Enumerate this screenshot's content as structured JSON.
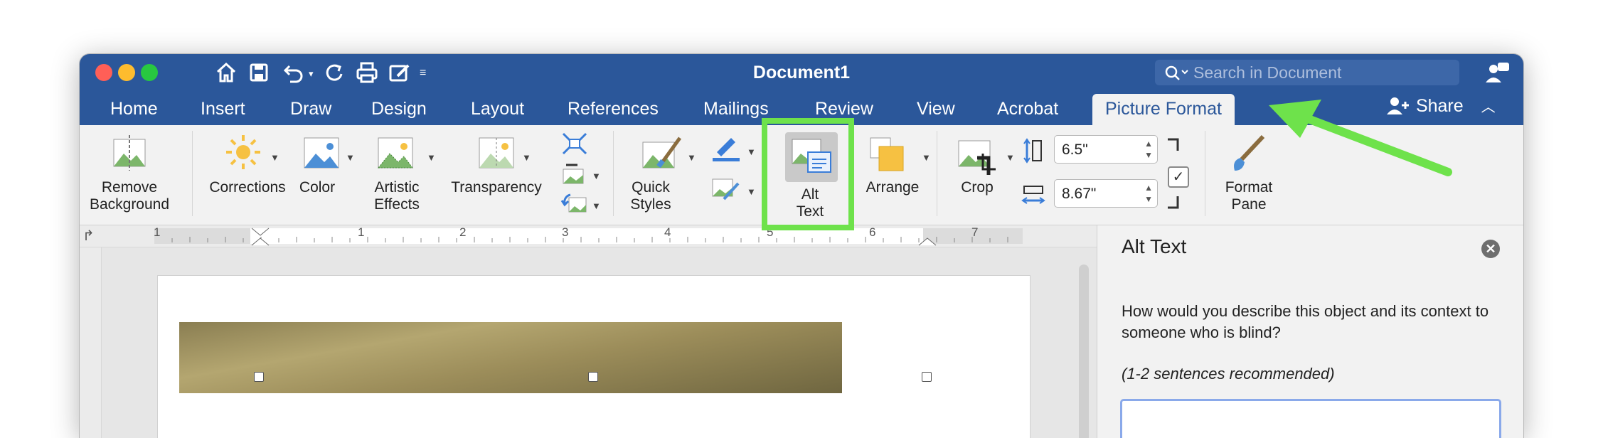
{
  "window": {
    "title": "Document1",
    "search_placeholder": "Search in Document"
  },
  "quick_access": [
    "home-icon",
    "save-icon",
    "undo-icon",
    "redo-icon",
    "print-icon",
    "edit-icon",
    "customize-icon"
  ],
  "tabs": [
    {
      "label": "Home"
    },
    {
      "label": "Insert"
    },
    {
      "label": "Draw"
    },
    {
      "label": "Design"
    },
    {
      "label": "Layout"
    },
    {
      "label": "References"
    },
    {
      "label": "Mailings"
    },
    {
      "label": "Review"
    },
    {
      "label": "View"
    },
    {
      "label": "Acrobat"
    },
    {
      "label": "Picture Format",
      "active": true
    }
  ],
  "share_label": "Share",
  "ribbon": {
    "remove_background": [
      "Remove",
      "Background"
    ],
    "corrections": "Corrections",
    "color": "Color",
    "artistic_effects": [
      "Artistic",
      "Effects"
    ],
    "transparency": "Transparency",
    "quick_styles": [
      "Quick",
      "Styles"
    ],
    "alt_text": [
      "Alt",
      "Text"
    ],
    "arrange": "Arrange",
    "crop": "Crop",
    "height_value": "6.5\"",
    "width_value": "8.67\"",
    "lock_aspect_checked": true,
    "format_pane": [
      "Format",
      "Pane"
    ]
  },
  "ruler_numbers": [
    "1",
    "1",
    "2",
    "3",
    "4",
    "5",
    "6",
    "7"
  ],
  "alt_text_pane": {
    "title": "Alt Text",
    "question": "How would you describe this object and its context to someone who is blind?",
    "recommendation": "(1-2 sentences recommended)",
    "textarea_value": ""
  },
  "colors": {
    "titlebar": "#2b579a",
    "highlight": "#6ee24b",
    "ribbon_bg": "#f2f2f2"
  }
}
